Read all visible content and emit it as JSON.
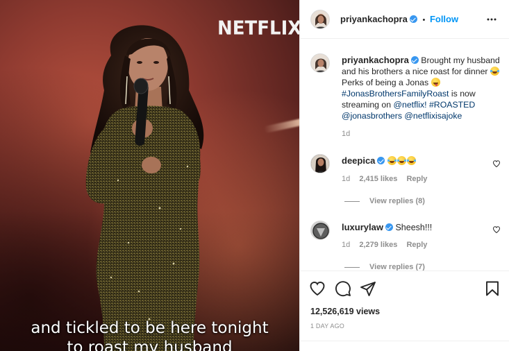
{
  "video": {
    "brand_logo": "NETFLIX",
    "subtitle_line1": "and tickled to be here tonight",
    "subtitle_line2": "to roast my husband"
  },
  "post_header": {
    "username": "priyankachopra",
    "separator": "•",
    "follow_label": "Follow",
    "more_icon": "more-horizontal-icon"
  },
  "caption": {
    "username": "priyankachopra",
    "text_part1": "Brought my husband and his brothers a nice roast for dinner",
    "text_part2": "Perks of being a Jonas",
    "hashtag1": "#JonasBrothersFamilyRoast",
    "text_part3": "is now streaming on",
    "mention1": "@netflix!",
    "hashtag2": "#ROASTED",
    "mention2": "@jonasbrothers",
    "mention3": "@netflixisajoke",
    "age": "1d"
  },
  "comments": [
    {
      "username": "deepica",
      "text": "",
      "emoji_count": 3,
      "age": "1d",
      "likes": "2,415 likes",
      "reply_label": "Reply",
      "view_replies": "View replies (8)"
    },
    {
      "username": "luxurylaw",
      "text": "Sheesh!!!",
      "age": "1d",
      "likes": "2,279 likes",
      "reply_label": "Reply",
      "view_replies": "View replies (7)"
    }
  ],
  "actions": {
    "like_icon": "heart-icon",
    "comment_icon": "comment-icon",
    "share_icon": "share-icon",
    "save_icon": "bookmark-icon",
    "views": "12,526,619 views",
    "timestamp": "1 DAY AGO"
  },
  "colors": {
    "link": "#00376b",
    "follow_blue": "#0095f6",
    "verified_blue": "#3897f0",
    "muted": "#8e8e8e"
  }
}
